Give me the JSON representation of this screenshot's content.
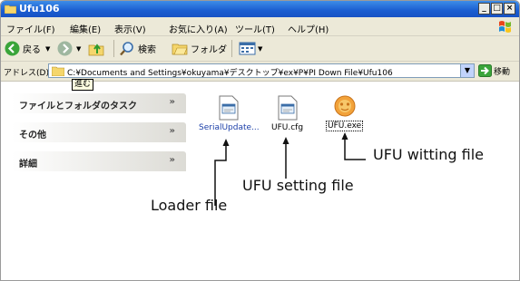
{
  "window": {
    "title": "Ufu106"
  },
  "menu": {
    "items": [
      "ファイル(F)",
      "編集(E)",
      "表示(V)",
      "お気に入り(A)",
      "ツール(T)",
      "ヘルプ(H)"
    ]
  },
  "toolbar": {
    "back": "戻る",
    "search": "検索",
    "folders": "フォルダ"
  },
  "address": {
    "label": "アドレス(D)",
    "path": "C:¥Documents and Settings¥okuyama¥デスクトップ¥ex¥P¥PI Down File¥Ufu106",
    "go": "移動",
    "tooltip": "進む"
  },
  "taskpane": {
    "sections": [
      "ファイルとフォルダのタスク",
      "その他",
      "詳細"
    ]
  },
  "files": [
    {
      "name": "SerialUpdate...",
      "icon": "config-file-icon"
    },
    {
      "name": "UFU.cfg",
      "icon": "config-file-icon"
    },
    {
      "name": "UFU.exe",
      "icon": "app-face-icon"
    }
  ],
  "annotations": {
    "loader": "Loader file",
    "setting": "UFU setting file",
    "writing": "UFU witting file"
  },
  "colors": {
    "titlebar": "#1a5dd0",
    "chrome": "#ece9d8"
  }
}
